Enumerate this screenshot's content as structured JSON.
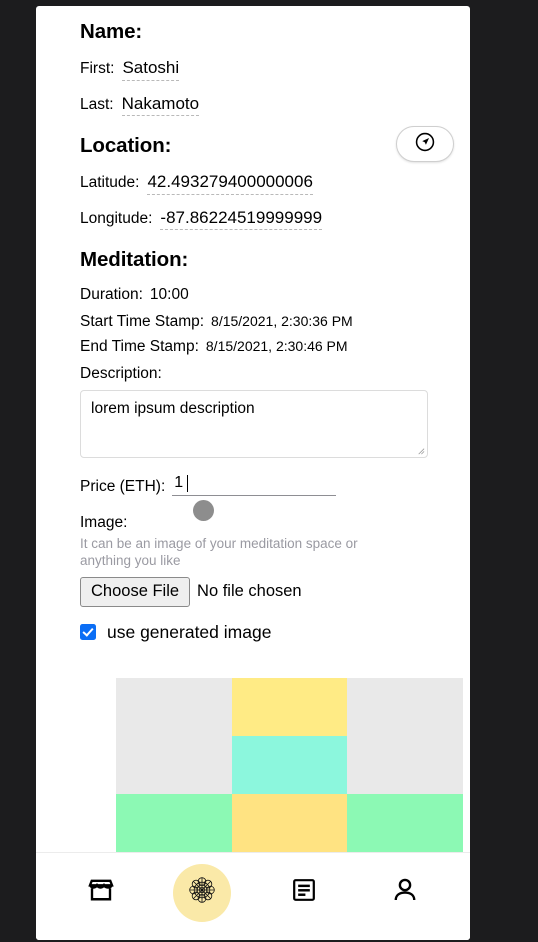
{
  "sections": {
    "name": {
      "heading": "Name:",
      "first_label": "First:",
      "first_value": "Satoshi",
      "last_label": "Last:",
      "last_value": "Nakamoto"
    },
    "location": {
      "heading": "Location:",
      "latitude_label": "Latitude:",
      "latitude_value": "42.493279400000006",
      "longitude_label": "Longitude:",
      "longitude_value": "-87.86224519999999",
      "locate_icon": "navigation-arrow-icon"
    },
    "meditation": {
      "heading": "Meditation:",
      "duration_label": "Duration:",
      "duration_value": "10:00",
      "start_label": "Start Time Stamp:",
      "start_value": "8/15/2021, 2:30:36 PM",
      "end_label": "End Time Stamp:",
      "end_value": "8/15/2021, 2:30:46 PM",
      "description_label": "Description:",
      "description_value": "lorem ipsum description",
      "price_label": "Price (ETH):",
      "price_value": "1"
    },
    "image": {
      "label": "Image:",
      "helper": "It can be an image of your meditation space or anything you like",
      "choose_file_label": "Choose File",
      "file_status": "No file chosen",
      "checkbox_label": "use generated image",
      "checkbox_checked": true
    }
  },
  "generated_image": {
    "background": "#e9e9e9",
    "cells": [
      "#e9e9e9",
      "#ffeb85",
      "#e9e9e9",
      "#e9e9e9",
      "#8cf7dd",
      "#e9e9e9",
      "#8cf9b4",
      "#ffe382",
      "#8cf9b4"
    ]
  },
  "bottom_nav": {
    "items": [
      {
        "name": "market-tab",
        "icon": "storefront-icon",
        "active": false
      },
      {
        "name": "meditate-tab",
        "icon": "mandala-icon",
        "active": true
      },
      {
        "name": "journal-tab",
        "icon": "article-icon",
        "active": false
      },
      {
        "name": "profile-tab",
        "icon": "person-icon",
        "active": false
      }
    ],
    "active_background": "#fae9a8"
  },
  "colors": {
    "page_background": "#1c1c1e",
    "card_background": "#ffffff",
    "checkbox_accent": "#0b6ef5",
    "helper_text": "#9a9aa2",
    "cursor": "#8d8d8d"
  }
}
